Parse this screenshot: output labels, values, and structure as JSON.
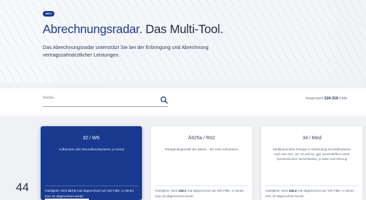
{
  "hero": {
    "badge": "NEU",
    "title_primary": "Abrechnungsradar.",
    "title_secondary": " Das Multi-Tool.",
    "subtitle": "Das Abrechnungsradar unterstützt Sie bei der Erbringung und Abrechnung vertragszahnärztlicher Leistungen."
  },
  "search": {
    "placeholder": "Suche...",
    "total_prefix": "Insgesamt ",
    "total_count": "224.319",
    "total_suffix": " Fälle"
  },
  "cards": [
    {
      "code": "32 / WK",
      "description": "Aufbereiten des Wurzelkanalsystems, je Kanal",
      "freq_prefix": "Häufigkeit: Wird ",
      "freq_count": "217,1",
      "freq_suffix": "-mal abgerechnet auf 100 Fälle, in denen eine 32 abgerechnet wurde",
      "active": true
    },
    {
      "code": "Ä925a / Rö2",
      "description": "Röntgendiagnostik der Zähne – bis zwei Aufnahmen",
      "freq_prefix": "Häufigkeit: Wird ",
      "freq_count": "145,1",
      "freq_suffix": "-mal abgerechnet auf 100 Fälle, in denen eine 32 abgerechnet wurde",
      "active": false
    },
    {
      "code": "34 / Med",
      "description": "Medikamentöse Einlage in Verbindung mit Maßnahmen nach den Nrn. 28, 29 und 32, ggf. einschließlich eines provisorischen Verschlusses, je Zahn und Sitzung",
      "freq_prefix": "Häufigkeit: Wird ",
      "freq_count": "145,4",
      "freq_suffix": "-mal abgerechnet auf 100 Fälle, in denen eine 32 abgerechnet wurde",
      "active": false
    }
  ],
  "page_number": "44",
  "colors": {
    "brand": "#1a3a8f",
    "background": "#eff1f5",
    "text": "#1f2d44"
  }
}
